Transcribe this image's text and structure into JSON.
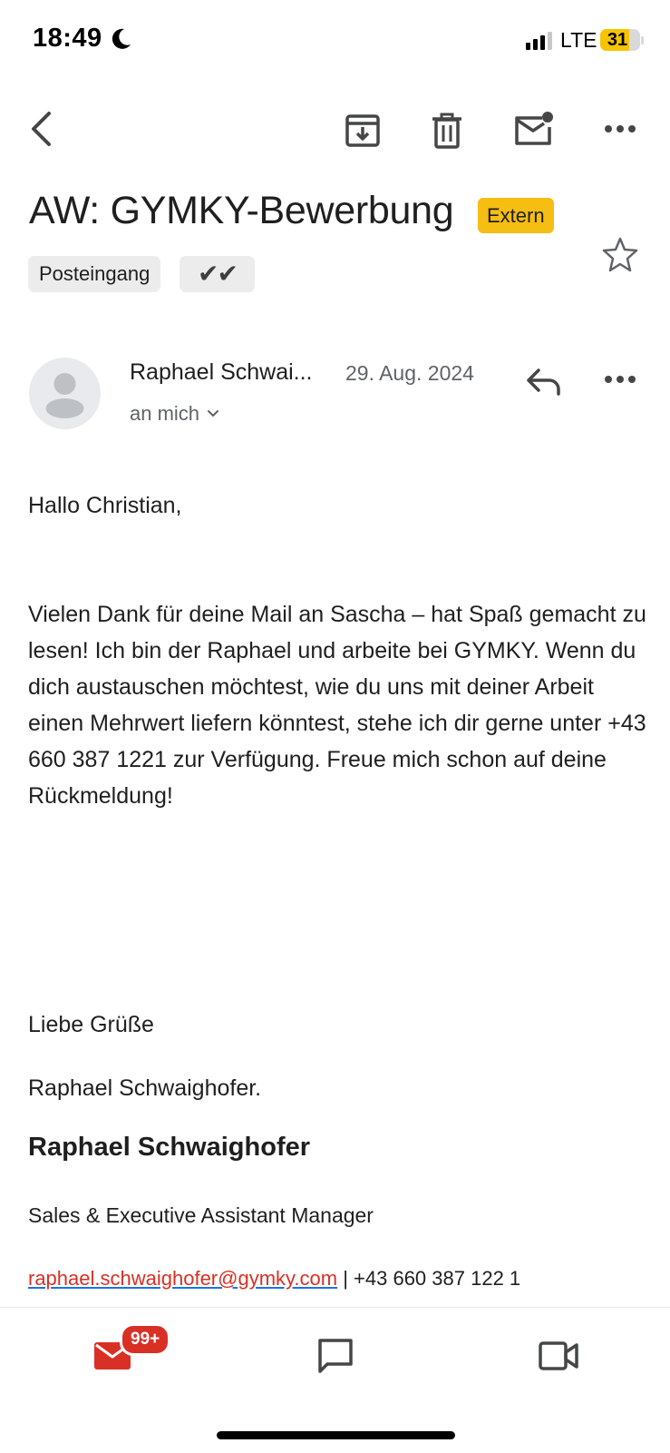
{
  "status_bar": {
    "time": "18:49",
    "network": "LTE",
    "battery": "31",
    "battery_level_percent": 31,
    "signal_bars_active": 3,
    "signal_bars_total": 4
  },
  "toolbar": {
    "back_icon": "chevron-left-icon",
    "archive_icon": "archive-icon",
    "delete_icon": "trash-icon",
    "mark_unread_icon": "mail-unread-icon",
    "more_icon": "more-horizontal-icon"
  },
  "email": {
    "subject": "AW: GYMKY-Bewerbung",
    "external_badge": "Extern",
    "labels": [
      "Posteingang",
      "✔✔"
    ],
    "starred": false,
    "sender_name": "Raphael Schwai...",
    "date": "29. Aug. 2024",
    "recipient": "an mich",
    "greeting": "Hallo Christian,",
    "paragraph": "Vielen Dank für deine Mail an Sascha – hat Spaß gemacht zu lesen! Ich bin der Raphael und arbeite bei GYMKY. Wenn du dich austauschen möchtest, wie du uns mit deiner Arbeit einen Mehrwert liefern könntest, stehe ich dir gerne unter +43 660 387 1221 zur Verfügung. Freue mich schon auf deine Rückmeldung!",
    "closing": "Liebe Grüße",
    "signoff": "Raphael Schwaighofer.",
    "signature": {
      "name": "Raphael Schwaighofer",
      "title": "Sales & Executive Assistant Manager",
      "email": "raphael.schwaighofer@gymky.com",
      "separator": " | ",
      "phone": "+43 660 387 122 1"
    }
  },
  "bottom_nav": {
    "mail_badge": "99+",
    "items": [
      "mail-icon",
      "chat-icon",
      "video-icon"
    ]
  },
  "colors": {
    "accent_red": "#d93025",
    "extern_badge": "#f6bd13",
    "link_underline": "#1a73e8",
    "chip_bg": "#ececec"
  }
}
